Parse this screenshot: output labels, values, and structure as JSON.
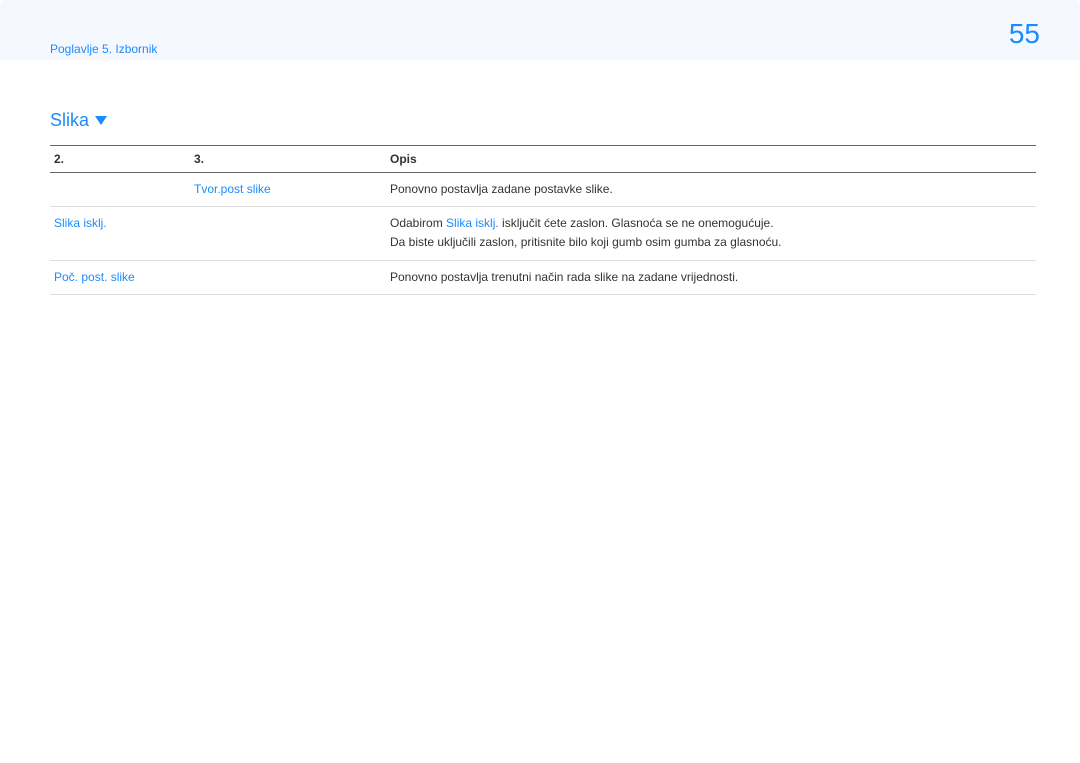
{
  "pageNumber": "55",
  "chapterLabel": "Poglavlje 5. Izbornik",
  "sectionTitle": "Slika",
  "table": {
    "headers": {
      "col1": "2.",
      "col2": "3.",
      "col3": "Opis"
    },
    "rows": [
      {
        "col1": "",
        "col2": "Tvor.post slike",
        "col2_blue": true,
        "col3_parts": [
          {
            "text": "Ponovno postavlja zadane postavke slike.",
            "blue": false
          }
        ]
      },
      {
        "col1": "Slika isklj.",
        "col1_blue": true,
        "col2": "",
        "col3_parts": [
          {
            "text": "Odabirom ",
            "blue": false
          },
          {
            "text": "Slika isklj.",
            "blue": true
          },
          {
            "text": " isključit ćete zaslon. Glasnoća se ne onemogućuje.",
            "blue": false
          }
        ],
        "col3_line2": "Da biste uključili zaslon, pritisnite bilo koji gumb osim gumba za glasnoću."
      },
      {
        "col1": "Poč. post. slike",
        "col1_blue": true,
        "col2": "",
        "col3_parts": [
          {
            "text": "Ponovno postavlja trenutni način rada slike na zadane vrijednosti.",
            "blue": false
          }
        ]
      }
    ]
  }
}
